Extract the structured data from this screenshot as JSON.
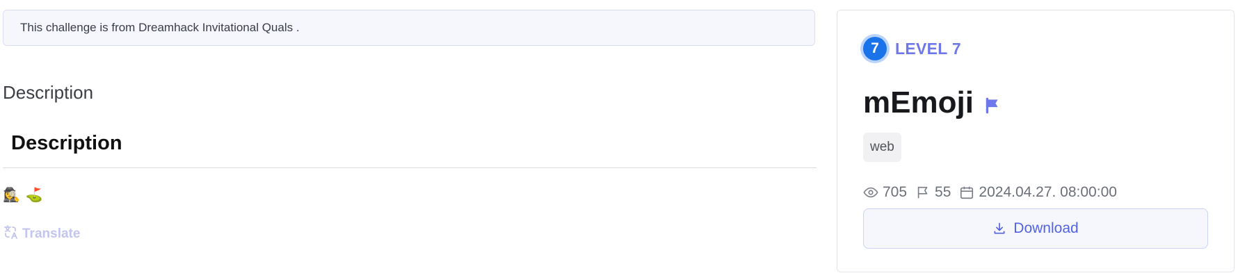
{
  "notice": {
    "text": "This challenge is from Dreamhack Invitational Quals ."
  },
  "main": {
    "section_title": "Description",
    "markdown_heading": "Description",
    "emojis": [
      "🕵️‍♀️",
      "⛳"
    ],
    "translate_label": "Translate"
  },
  "sidebar": {
    "level_number": "7",
    "level_label": "LEVEL 7",
    "title": "mEmoji",
    "tag": "web",
    "views": "705",
    "solves": "55",
    "date": "2024.04.27. 08:00:00",
    "download_label": "Download"
  },
  "colors": {
    "accent": "#5262e6",
    "level_blue": "#1a73e8",
    "level_text": "#6f78ea",
    "translate": "#c3c5ee"
  },
  "icons": [
    "translate-icon",
    "flag-icon",
    "eye-icon",
    "solves-flag-icon",
    "calendar-icon",
    "download-icon"
  ]
}
